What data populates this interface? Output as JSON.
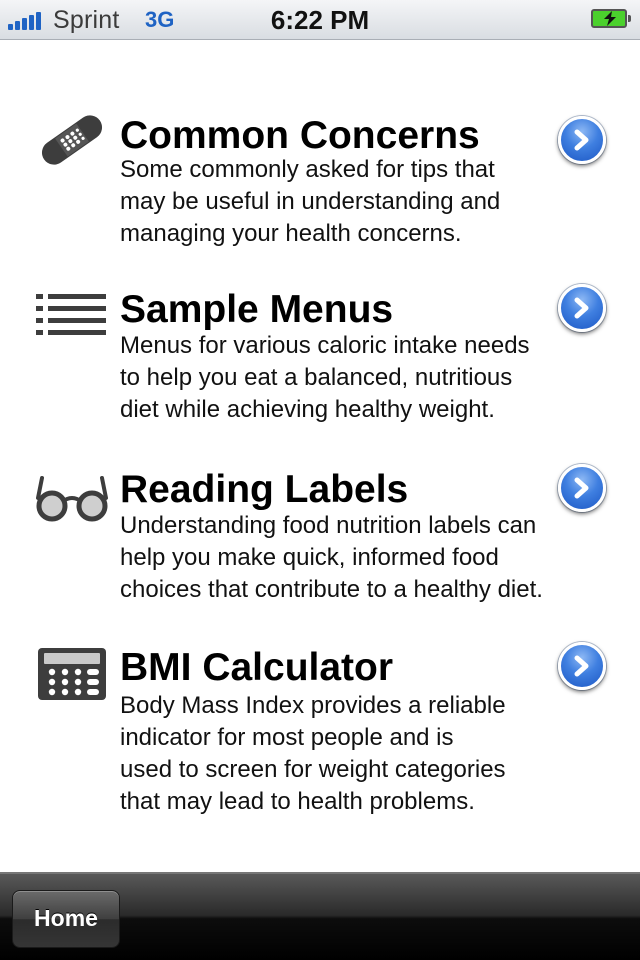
{
  "status_bar": {
    "carrier": "Sprint",
    "network": "3G",
    "time": "6:22 PM",
    "battery_icon": "battery-charging-icon",
    "signal_icon": "signal-strength-icon"
  },
  "menu": {
    "items": [
      {
        "icon": "bandage-icon",
        "title": "Common Concerns",
        "description": [
          "Some commonly asked for tips that",
          "may be useful in understanding and",
          "managing your health concerns."
        ]
      },
      {
        "icon": "list-icon",
        "title": "Sample Menus",
        "description": [
          "Menus for various caloric intake needs",
          "to help you eat a balanced, nutritious",
          "diet while achieving healthy weight."
        ]
      },
      {
        "icon": "glasses-icon",
        "title": "Reading Labels",
        "description": [
          "Understanding food nutrition labels can",
          "help you make quick, informed food",
          "choices that contribute to a healthy diet."
        ]
      },
      {
        "icon": "calculator-icon",
        "title": "BMI Calculator",
        "description": [
          "Body Mass Index provides a reliable",
          "indicator for most people and is",
          "used to screen for weight categories",
          "that may lead to health problems."
        ]
      }
    ]
  },
  "tab_bar": {
    "home_label": "Home"
  },
  "colors": {
    "accent_blue": "#1f63c4",
    "icon_gray": "#3d3d3d",
    "battery_green": "#4bd12d"
  }
}
